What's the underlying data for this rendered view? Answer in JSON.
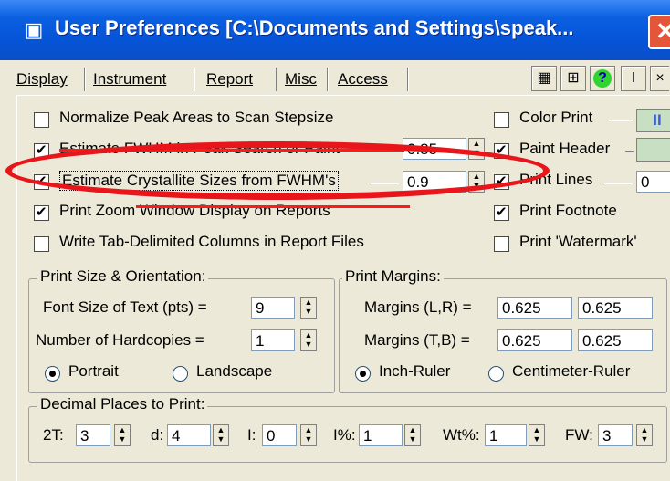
{
  "window": {
    "title": "User Preferences [C:\\Documents and Settings\\speak...",
    "close": "✕",
    "icon": "app-icon"
  },
  "tabs": [
    {
      "label": "Display"
    },
    {
      "label": "Instrument"
    },
    {
      "label": "Report",
      "active": true
    },
    {
      "label": "Misc"
    },
    {
      "label": "Access"
    }
  ],
  "toolbar": {
    "icons": [
      "grid-icon",
      "table-icon",
      "help-icon",
      "cursor-icon"
    ],
    "info_label": "I"
  },
  "options": [
    {
      "label": "Normalize Peak Areas to Scan Stepsize",
      "checked": false
    },
    {
      "label": "Estimate FWHM in Peak Search or Paint",
      "checked": true,
      "value": "0.85"
    },
    {
      "label": "Estimate Crystallite Sizes from FWHM's",
      "checked": true,
      "value": "0.9"
    },
    {
      "label": "Print Zoom Window Display on Reports",
      "checked": true
    },
    {
      "label": "Write Tab-Delimited Columns in Report Files",
      "checked": false
    }
  ],
  "print_opts": [
    {
      "label": "Color Print",
      "checked": false,
      "swatch": "II"
    },
    {
      "label": "Paint Header",
      "checked": true
    },
    {
      "label": "Print Lines",
      "checked": true,
      "value": "0"
    },
    {
      "label": "Print Footnote",
      "checked": true
    },
    {
      "label": "Print 'Watermark'",
      "checked": false
    }
  ],
  "size_orientation": {
    "title": "Print Size & Orientation:",
    "font_label": "Font Size of Text (pts) =",
    "font_value": "9",
    "copies_label": "Number of Hardcopies =",
    "copies_value": "1",
    "portrait": "Portrait",
    "landscape": "Landscape",
    "selected": "Portrait"
  },
  "margins": {
    "title": "Print Margins:",
    "lr_label": "Margins (L,R) =",
    "lr": [
      "0.625",
      "0.625"
    ],
    "tb_label": "Margins (T,B) =",
    "tb": [
      "0.625",
      "0.625"
    ],
    "inch": "Inch-Ruler",
    "cm": "Centimeter-Ruler",
    "selected": "Inch-Ruler"
  },
  "decimals": {
    "title": "Decimal Places to Print:",
    "items": [
      {
        "label": "2T:",
        "value": "3"
      },
      {
        "label": "d:",
        "value": "4"
      },
      {
        "label": "I:",
        "value": "0"
      },
      {
        "label": "I%:",
        "value": "1"
      },
      {
        "label": "Wt%:",
        "value": "1"
      },
      {
        "label": "FW:",
        "value": "3"
      }
    ]
  },
  "colors": {
    "annotation": "#e8151b",
    "titlebar": "#0653d6",
    "swatch_blue": "#3a5fd8",
    "swatch_green": "#c9dfc3"
  }
}
